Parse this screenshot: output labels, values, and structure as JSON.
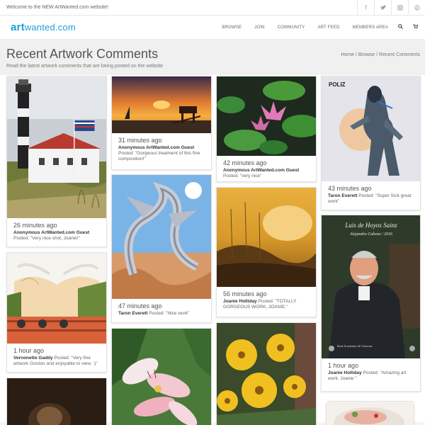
{
  "topbar": {
    "welcome": "Welcome to the NEW ArtWanted.com website!",
    "social_icons": [
      "facebook-icon",
      "twitter-icon",
      "instagram-icon",
      "pinterest-icon"
    ]
  },
  "brand": {
    "logo_art": "art",
    "logo_rest": "wanted.com",
    "color": "#1e9fd6"
  },
  "nav": {
    "items": [
      "BROWSE",
      "JOIN",
      "COMMUNITY",
      "ART FEED",
      "MEMBERS AREA"
    ]
  },
  "page": {
    "title": "Recent Artwork Comments",
    "subtitle": "Read the latest artwork comments that are being posted on the website",
    "breadcrumb": {
      "home": "Home",
      "sep1": " / ",
      "browse": "Browse",
      "sep2": " / ",
      "current": "Recent Comments"
    }
  },
  "cards": [
    {
      "time": "26 minutes ago",
      "author": "Anonymous ArtWanted.com Guest",
      "posted": "",
      "comment": "Posted: \"Very nice shot, Joanie!\"",
      "image": "lighthouse"
    },
    {
      "time": "1 hour ago",
      "author": "Vernonette Gaddy",
      "posted": " Posted: \"Very fine artwork Gordon and enjoyable to view. :)\"",
      "comment": "",
      "image": "highland-cow"
    },
    {
      "time": "",
      "author": "",
      "posted": "",
      "comment": "",
      "image": "dark-portrait"
    },
    {
      "time": "31 minutes ago",
      "author": "Anonymous ArtWanted.com Guest",
      "posted": "",
      "comment": "Posted: \"Gorgeous treatment of this fine composition!\"",
      "image": "sunset-lifeguard"
    },
    {
      "time": "47 minutes ago",
      "author": "Taron Everett",
      "posted": " Posted: \"Nice work\"",
      "comment": "",
      "image": "chrome-dragon"
    },
    {
      "time": "",
      "author": "",
      "posted": "",
      "comment": "",
      "image": "pink-lilies"
    },
    {
      "time": "42 minutes ago",
      "author": "Anonymous ArtWanted.com Guest",
      "posted": "",
      "comment": "Posted: \"very nice\"",
      "image": "water-lilies"
    },
    {
      "time": "56 minutes ago",
      "author": "Joanie Holliday",
      "posted": " Posted: \"TOTALLY GORGEOUS WORK, JOANIE.\"",
      "comment": "",
      "image": "golden-landscape"
    },
    {
      "time": "",
      "author": "",
      "posted": "",
      "comment": "",
      "image": "yellow-flowers"
    },
    {
      "time": "43 minutes ago",
      "author": "Taron Everett",
      "posted": " Posted: \"Super Sick great work\"",
      "comment": "",
      "image": "robot"
    },
    {
      "time": "1 hour ago",
      "author": "Joanie Holliday",
      "posted": " Posted: \"Amazing art work. Joanie \"",
      "comment": "",
      "image": "painted-portrait"
    },
    {
      "time": "",
      "author": "",
      "posted": "",
      "comment": "",
      "image": "food-plate"
    }
  ],
  "artwork_text": {
    "robot_tag": "POLIZ",
    "portrait_name": "Luis de Hoyos Sainz",
    "portrait_artist": "Alejandro Cabeza / 2016",
    "portrait_footer": "Real Academia de Ciencias"
  }
}
